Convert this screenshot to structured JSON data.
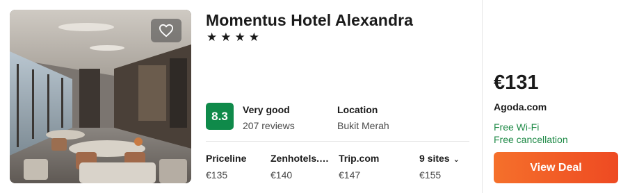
{
  "hotel": {
    "name": "Momentus Hotel Alexandra",
    "stars": "★★★★",
    "photo_icon": "hotel-lobby-photo",
    "favorite_icon": "heart-outline-icon"
  },
  "rating": {
    "score": "8.3",
    "label": "Very good",
    "reviews": "207 reviews",
    "color": "#0f8a4a"
  },
  "location": {
    "label": "Location",
    "value": "Bukit Merah"
  },
  "sites": [
    {
      "name": "Priceline",
      "price": "€135"
    },
    {
      "name": "Zenhotels.com",
      "price": "€140"
    },
    {
      "name": "Trip.com",
      "price": "€147"
    }
  ],
  "more_sites": {
    "label": "9 sites",
    "price": "€155",
    "icon": "chevron-down-icon"
  },
  "deal": {
    "price": "€131",
    "provider": "Agoda.com",
    "amenities": [
      "Free Wi-Fi",
      "Free cancellation"
    ],
    "button_label": "View Deal",
    "accent": "#f5702b",
    "amenity_color": "#1f8a47"
  }
}
